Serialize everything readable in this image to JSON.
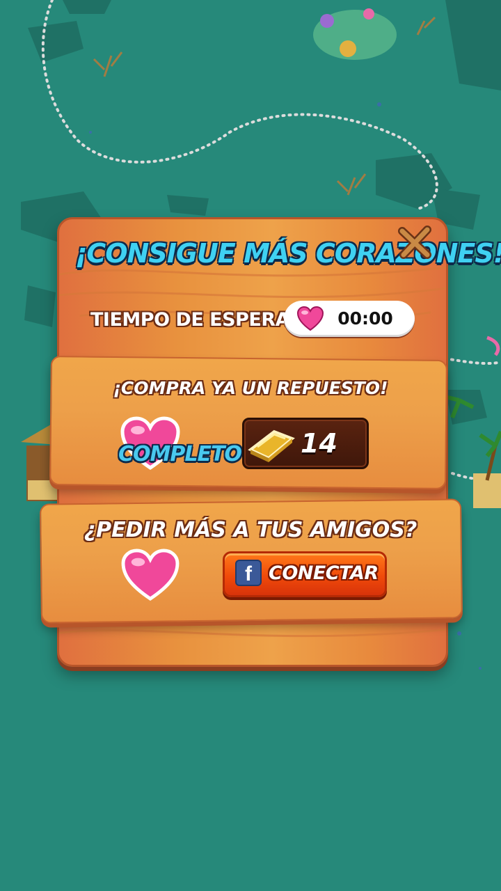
{
  "dialog": {
    "title": "¡CONSIGUE MÁS CORAZONES!",
    "close_icon": "close-x-icon"
  },
  "wait": {
    "label": "TIEMPO DE ESPERA",
    "timer": "00:00",
    "icon": "heart-icon"
  },
  "buy": {
    "title": "¡COMPRA YA UN REPUESTO!",
    "status_label": "COMPLETO",
    "price": "14",
    "currency_icon": "gold-bar-icon"
  },
  "friends": {
    "title": "¿PEDIR MÁS A TUS AMIGOS?",
    "connect_label": "CONECTAR",
    "connect_icon": "facebook-icon"
  },
  "colors": {
    "background": "#26897a",
    "heart": "#f0489a",
    "title_blue": "#3fd1f2",
    "connect_orange": "#f04a0a",
    "facebook_blue": "#3b5998"
  }
}
